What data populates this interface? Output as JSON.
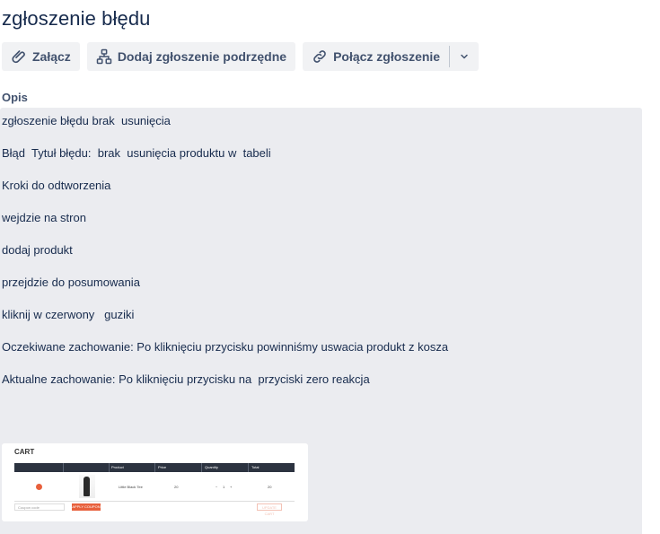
{
  "issue": {
    "title": "zgłoszenie błędu"
  },
  "toolbar": {
    "attach_label": "Załącz",
    "add_child_label": "Dodaj zgłoszenie podrzędne",
    "link_label": "Połącz zgłoszenie"
  },
  "description": {
    "label": "Opis",
    "lines": [
      "zgłoszenie błędu brak  usunięcia",
      "Błąd  Tytuł błędu:  brak  usunięcia produktu w  tabeli",
      "Kroki do odtworzenia",
      "wejdzie na stron",
      "dodaj produkt",
      "przejdzie do posumowania",
      "kliknij w czerwony   guziki",
      "Oczekiwane zachowanie: Po kliknięciu przycisku powinniśmy uswacia produkt z kosza",
      "Aktualne zachowanie: Po kliknięciu przycisku na  przyciski zero reakcja"
    ]
  },
  "attachment": {
    "title": "CART",
    "headers": [
      "Product",
      "Price",
      "Quantity",
      "Total"
    ],
    "row": {
      "product": "Little Black Tee",
      "price": "20",
      "quantity": "1",
      "total": "20"
    },
    "coupon_placeholder": "Coupon code",
    "apply_label": "APPLY COUPON",
    "update_label": "UPDATE CART"
  },
  "colors": {
    "text": "#172b4d",
    "button_bg": "#f1f2f4",
    "description_bg": "#ebecf0",
    "accent": "#e8603c"
  }
}
